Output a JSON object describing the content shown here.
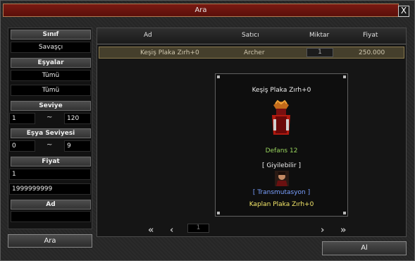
{
  "window": {
    "title": "Ara",
    "close_label": "X"
  },
  "filters": {
    "class_header": "Sınıf",
    "class_value": "Savaşçı",
    "items_header": "Eşyalar",
    "item_type_1": "Tümü",
    "item_type_2": "Tümü",
    "level_header": "Seviye",
    "level_min": "1",
    "level_max": "120",
    "item_level_header": "Eşya Seviyesi",
    "item_level_min": "0",
    "item_level_max": "9",
    "price_header": "Fiyat",
    "price_min": "1",
    "price_max": "1999999999",
    "name_header": "Ad",
    "name_value": "",
    "range_sep": "~",
    "search_button": "Ara"
  },
  "results": {
    "columns": [
      "Ad",
      "Satıcı",
      "Miktar",
      "Fiyat"
    ],
    "rows": [
      {
        "name": "Keşiş Plaka Zırh+0",
        "seller": "Archer",
        "quantity": "1",
        "price": "250.000"
      }
    ]
  },
  "tooltip": {
    "item_name": "Keşiş Plaka Zırh+0",
    "defense": "Defans 12",
    "wearable": "[ Giyilebilir ]",
    "transmutation": "[ Transmutasyon ]",
    "transmuted_name": "Kaplan Plaka Zırh+0",
    "icon": "armor-icon",
    "portrait": "warrior-portrait-icon",
    "colors": {
      "defense": "#9ad65f",
      "wearable": "#f0f0f0",
      "transmutation": "#7aa0ff",
      "transmuted_name": "#f5e86a"
    }
  },
  "pagination": {
    "first": "«",
    "prev": "‹",
    "page": "1",
    "next": "›",
    "last": "»"
  },
  "buy_button": "Al"
}
